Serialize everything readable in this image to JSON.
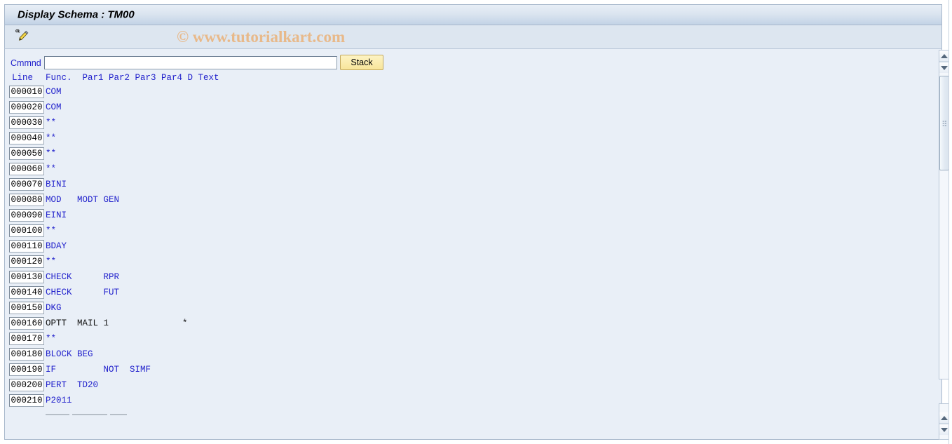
{
  "window": {
    "title": "Display Schema : TM00"
  },
  "toolbar": {
    "change_icon": "pencil-edit-icon",
    "watermark": "© www.tutorialkart.com"
  },
  "command": {
    "label": "Cmmnd",
    "value": "",
    "placeholder": "",
    "stack_label": "Stack"
  },
  "grid": {
    "header_line": "Line",
    "header_columns": "Func.  Par1 Par2 Par3 Par4 D Text",
    "columns": [
      "Line",
      "Func.",
      "Par1",
      "Par2",
      "Par3",
      "Par4",
      "D",
      "Text"
    ],
    "rows": [
      {
        "line": "000010",
        "content": "COM",
        "dark": false
      },
      {
        "line": "000020",
        "content": "COM",
        "dark": false
      },
      {
        "line": "000030",
        "content": "**",
        "dark": false
      },
      {
        "line": "000040",
        "content": "**",
        "dark": false
      },
      {
        "line": "000050",
        "content": "**",
        "dark": false
      },
      {
        "line": "000060",
        "content": "**",
        "dark": false
      },
      {
        "line": "000070",
        "content": "BINI",
        "dark": false
      },
      {
        "line": "000080",
        "content": "MOD   MODT GEN",
        "dark": false
      },
      {
        "line": "000090",
        "content": "EINI",
        "dark": false
      },
      {
        "line": "000100",
        "content": "**",
        "dark": false
      },
      {
        "line": "000110",
        "content": "BDAY",
        "dark": false
      },
      {
        "line": "000120",
        "content": "**",
        "dark": false
      },
      {
        "line": "000130",
        "content": "CHECK      RPR",
        "dark": false
      },
      {
        "line": "000140",
        "content": "CHECK      FUT",
        "dark": false
      },
      {
        "line": "000150",
        "content": "DKG",
        "dark": false
      },
      {
        "line": "000160",
        "content": "OPTT  MAIL 1              *",
        "dark": true
      },
      {
        "line": "000170",
        "content": "**",
        "dark": false
      },
      {
        "line": "000180",
        "content": "BLOCK BEG",
        "dark": false
      },
      {
        "line": "000190",
        "content": "IF         NOT  SIMF",
        "dark": false
      },
      {
        "line": "000200",
        "content": "PERT  TD20",
        "dark": false
      },
      {
        "line": "000210",
        "content": "P2011",
        "dark": false
      }
    ]
  },
  "scrollbars": {
    "up_arrow": "scroll-up-arrow-icon",
    "down_arrow": "scroll-down-arrow-icon"
  },
  "colors": {
    "title_bar": "#c3d3e6",
    "body_bg": "#e9eff7",
    "text_blue": "#2222cc",
    "stack_button": "#f8e59a",
    "watermark": "#e8b98a"
  }
}
